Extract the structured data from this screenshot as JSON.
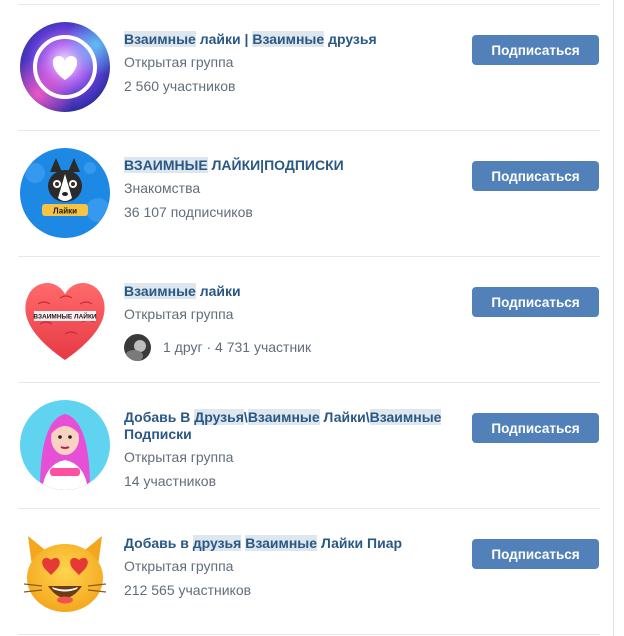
{
  "groups": [
    {
      "title_parts": [
        {
          "t": "Взаимные",
          "h": true
        },
        {
          "t": " лайки | ",
          "h": false
        },
        {
          "t": "Взаимные",
          "h": true
        },
        {
          "t": " друзья",
          "h": false
        }
      ],
      "line1": "Открытая группа",
      "line2": "2 560 участников",
      "button": "Подписаться",
      "avatar_icon": "glowing-heart-logo"
    },
    {
      "title_parts": [
        {
          "t": "ВЗАИМНЫЕ",
          "h": true
        },
        {
          "t": " ЛАЙКИ|ПОДПИСКИ",
          "h": false
        }
      ],
      "line1": "Знакомства",
      "line2": "36 107 подписчиков",
      "button": "Подписаться",
      "avatar_icon": "husky-dog-logo",
      "avatar_text": "Лайки"
    },
    {
      "title_parts": [
        {
          "t": "Взаимные",
          "h": true
        },
        {
          "t": " лайки",
          "h": false
        }
      ],
      "line1": "Открытая группа",
      "friends_text": "1 друг · 4 731 участник",
      "button": "Подписаться",
      "avatar_icon": "puzzle-heart-logo",
      "avatar_text": "ВЗАИМНЫЕ ЛАЙКИ"
    },
    {
      "title_parts": [
        {
          "t": "Добавь В ",
          "h": false
        },
        {
          "t": "Друзья",
          "h": true
        },
        {
          "t": "\\",
          "h": false
        },
        {
          "t": "Взаимные",
          "h": true
        },
        {
          "t": " Лайки\\",
          "h": false
        },
        {
          "t": "Взаимные",
          "h": true
        },
        {
          "t": " Подписки",
          "h": false
        }
      ],
      "line1": "Открытая группа",
      "line2": "14 участников",
      "button": "Подписаться",
      "avatar_icon": "pink-hair-girl-logo"
    },
    {
      "title_parts": [
        {
          "t": "Добавь в ",
          "h": false
        },
        {
          "t": "друзья",
          "h": true
        },
        {
          "t": " ",
          "h": false
        },
        {
          "t": "Взаимные",
          "h": true
        },
        {
          "t": " Лайки Пиар",
          "h": false
        }
      ],
      "line1": "Открытая группа",
      "line2": "212 565 участников",
      "button": "Подписаться",
      "avatar_icon": "heart-eyes-cat-emoji"
    }
  ],
  "colors": {
    "link": "#2a5885",
    "secondary": "#626d7a",
    "button": "#5181b8",
    "highlight": "#dee6ee"
  }
}
